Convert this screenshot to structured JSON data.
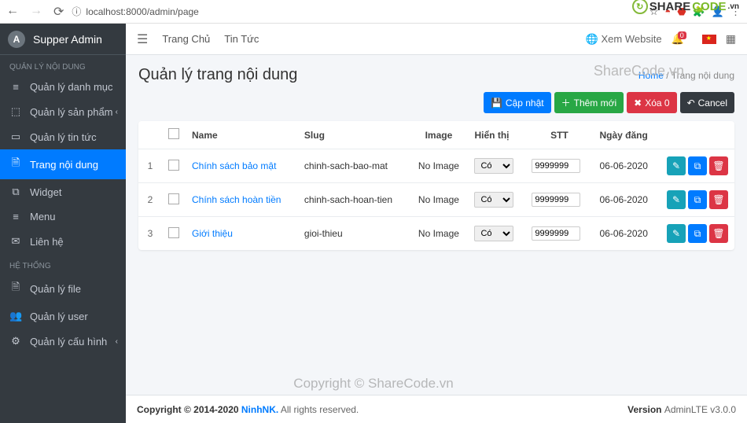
{
  "browser": {
    "url": "localhost:8000/admin/page"
  },
  "brand": "Supper Admin",
  "sidebar": {
    "section_content": "QUẢN LÝ NỘI DUNG",
    "section_system": "HỆ THỐNG",
    "items_content": [
      {
        "label": "Quản lý danh mục",
        "icon": "≡"
      },
      {
        "label": "Quản lý sản phẩm",
        "icon": "⬚",
        "caret": true
      },
      {
        "label": "Quản lý tin tức",
        "icon": "▭"
      },
      {
        "label": "Trang nội dung",
        "icon": "🗎",
        "active": true
      },
      {
        "label": "Widget",
        "icon": "⧉"
      },
      {
        "label": "Menu",
        "icon": "≡"
      },
      {
        "label": "Liên hệ",
        "icon": "✉"
      }
    ],
    "items_system": [
      {
        "label": "Quản lý file",
        "icon": "🗎"
      },
      {
        "label": "Quản lý user",
        "icon": "👥"
      },
      {
        "label": "Quản lý cấu hình",
        "icon": "⚙",
        "caret": true
      }
    ]
  },
  "topbar": {
    "nav": [
      "Trang Chủ",
      "Tin Tức"
    ],
    "view_site": "Xem Website",
    "notif_count": "0"
  },
  "head": {
    "title": "Quản lý trang nội dung",
    "crumb_home": "Home",
    "crumb_sep": " / ",
    "crumb_current": "Trang nội dung"
  },
  "actions": {
    "update": "Cập nhật",
    "add": "Thêm mới",
    "delete": "Xóa 0",
    "cancel": "Cancel"
  },
  "table": {
    "headers": {
      "name": "Name",
      "slug": "Slug",
      "image": "Image",
      "visible": "Hiển thị",
      "order": "STT",
      "date": "Ngày đăng"
    },
    "rows": [
      {
        "idx": "1",
        "name": "Chính sách bảo mật",
        "slug": "chinh-sach-bao-mat",
        "image": "No Image",
        "visible": "Có",
        "order": "9999999",
        "date": "06-06-2020"
      },
      {
        "idx": "2",
        "name": "Chính sách hoàn tiền",
        "slug": "chinh-sach-hoan-tien",
        "image": "No Image",
        "visible": "Có",
        "order": "9999999",
        "date": "06-06-2020"
      },
      {
        "idx": "3",
        "name": "Giới thiệu",
        "slug": "gioi-thieu",
        "image": "No Image",
        "visible": "Có",
        "order": "9999999",
        "date": "06-06-2020"
      }
    ]
  },
  "footer": {
    "copyright_pre": "Copyright © 2014-2020 ",
    "brand": "NinhNK.",
    "copyright_post": " All rights reserved.",
    "version_label": "Version ",
    "version": "AdminLTE v3.0.0"
  },
  "watermarks": {
    "top": "ShareCode.vn",
    "center": "Copyright © ShareCode.vn",
    "logo_text_a": "SHARE",
    "logo_text_b": "CODE",
    "logo_text_c": ".vn"
  }
}
